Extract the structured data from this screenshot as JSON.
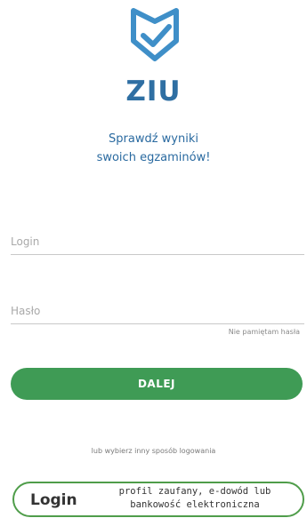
{
  "app": {
    "logo_icon": "ziu-badge-check-icon",
    "name": "ZIU",
    "tagline_line1": "Sprawdź wyniki",
    "tagline_line2": "swoich egzaminów!",
    "brand_color": "#2f6fa3"
  },
  "form": {
    "login_placeholder": "Login",
    "login_value": "",
    "password_placeholder": "Hasło",
    "password_value": "",
    "forgot_password": "Nie pamiętam hasła",
    "submit_label": "DALEJ",
    "submit_color": "#3f9b55"
  },
  "alt_login": {
    "divider_text": "lub wybierz inny sposób logowania",
    "provider_wordmark": "Login",
    "provider_line1": "profil zaufany, e-dowód lub",
    "provider_line2": "bankowość elektroniczna",
    "border_color": "#4f9d4a"
  }
}
